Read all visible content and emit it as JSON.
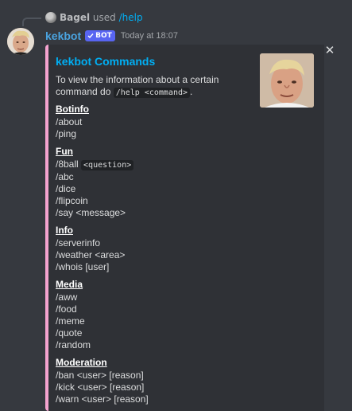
{
  "reply": {
    "user": "Bagel",
    "used": "used",
    "command": "/help"
  },
  "message": {
    "username": "kekbot",
    "bot_tag": "BOT",
    "timestamp": "Today at 18:07"
  },
  "embed": {
    "title": "kekbot Commands",
    "desc_pre": "To view the information about a certain command do",
    "desc_code": "/help <command>",
    "desc_post": ".",
    "accent_color": "#f5a3cf",
    "fields": [
      {
        "name": "Botinfo",
        "lines": [
          [
            "/about"
          ],
          [
            "/ping"
          ]
        ]
      },
      {
        "name": "Fun",
        "lines": [
          [
            "/8ball",
            "<question>"
          ],
          [
            "/abc"
          ],
          [
            "/dice"
          ],
          [
            "/flipcoin"
          ],
          [
            "/say <message>"
          ]
        ]
      },
      {
        "name": "Info",
        "lines": [
          [
            "/serverinfo"
          ],
          [
            "/weather <area>"
          ],
          [
            "/whois [user]"
          ]
        ]
      },
      {
        "name": "Media",
        "lines": [
          [
            "/aww"
          ],
          [
            "/food"
          ],
          [
            "/meme"
          ],
          [
            "/quote"
          ],
          [
            "/random"
          ]
        ]
      },
      {
        "name": "Moderation",
        "lines": [
          [
            "/ban <user> [reason]"
          ],
          [
            "/kick <user> [reason]"
          ],
          [
            "/warn <user> [reason]"
          ]
        ]
      }
    ]
  },
  "icons": {
    "close": "close-icon",
    "check": "check-icon"
  },
  "colors": {
    "background": "#36393f",
    "embed_bg": "#2f3136",
    "link": "#00aff4",
    "username": "#4aa3df",
    "bot_tag": "#5865f2"
  }
}
